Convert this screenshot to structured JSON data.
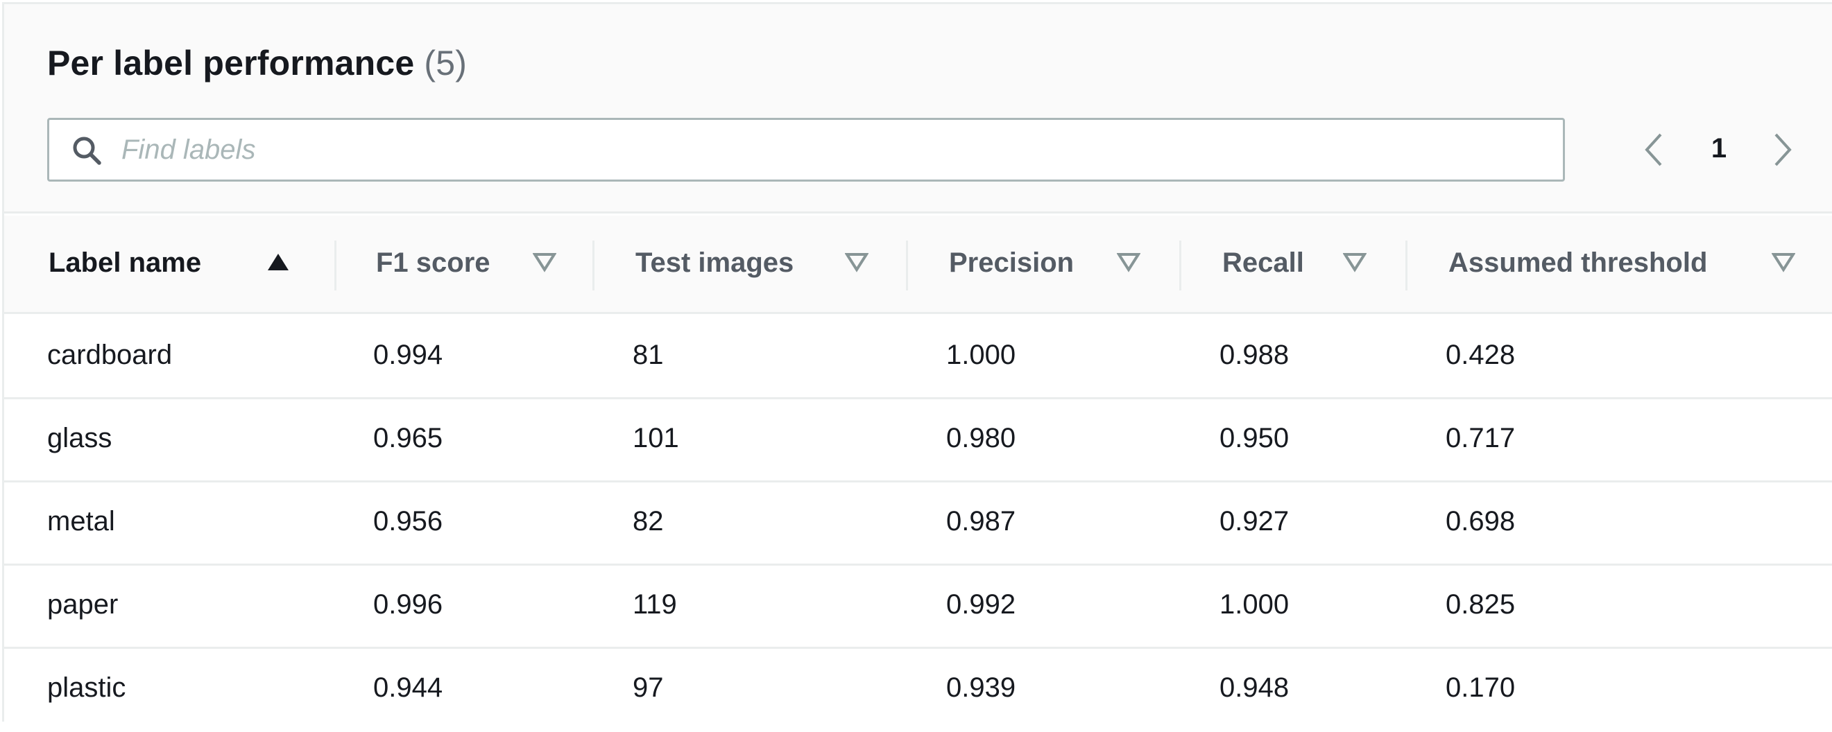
{
  "header": {
    "title": "Per label performance",
    "count": "(5)"
  },
  "search": {
    "placeholder": "Find labels",
    "value": "",
    "icon": "search-icon"
  },
  "pagination": {
    "current_page": "1",
    "prev_icon": "chevron-left-icon",
    "next_icon": "chevron-right-icon"
  },
  "table": {
    "columns": [
      {
        "label": "Label name",
        "sort": "ascending"
      },
      {
        "label": "F1 score",
        "sort": "none"
      },
      {
        "label": "Test images",
        "sort": "none"
      },
      {
        "label": "Precision",
        "sort": "none"
      },
      {
        "label": "Recall",
        "sort": "none"
      },
      {
        "label": "Assumed threshold",
        "sort": "none"
      }
    ],
    "rows": [
      [
        "cardboard",
        "0.994",
        "81",
        "1.000",
        "0.988",
        "0.428"
      ],
      [
        "glass",
        "0.965",
        "101",
        "0.980",
        "0.950",
        "0.717"
      ],
      [
        "metal",
        "0.956",
        "82",
        "0.987",
        "0.927",
        "0.698"
      ],
      [
        "paper",
        "0.996",
        "119",
        "0.992",
        "1.000",
        "0.825"
      ],
      [
        "plastic",
        "0.944",
        "97",
        "0.939",
        "0.948",
        "0.170"
      ]
    ]
  },
  "colors": {
    "header_bg": "#fafafa",
    "border": "#eaeded",
    "text": "#16191f",
    "muted_text": "#545b64",
    "placeholder": "#aab7b8",
    "sort_icon_inactive": "#879596"
  }
}
